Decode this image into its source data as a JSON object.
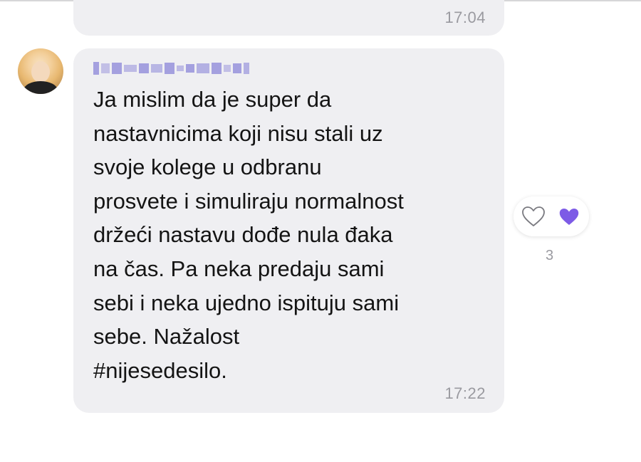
{
  "previous_message": {
    "time": "17:04"
  },
  "message": {
    "sender_name": "",
    "text": "Ja mislim da je super da\nnastavnicima koji nisu stali uz\nsvoje kolege u odbranu\nprosvete i simuliraju normalnost\ndržeći nastavu dođe nula đaka\nna čas. Pa neka predaju sami\nsebi i neka ujedno ispituju sami\nsebe. Nažalost\n #nijesedesilo.",
    "time": "17:22"
  },
  "reactions": {
    "like_empty_icon": "heart-outline-icon",
    "like_filled_icon": "heart-filled-icon",
    "count": "3"
  },
  "colors": {
    "bubble": "#efeff2",
    "accent": "#7d5be6",
    "timestamp": "#9a9aa0"
  }
}
